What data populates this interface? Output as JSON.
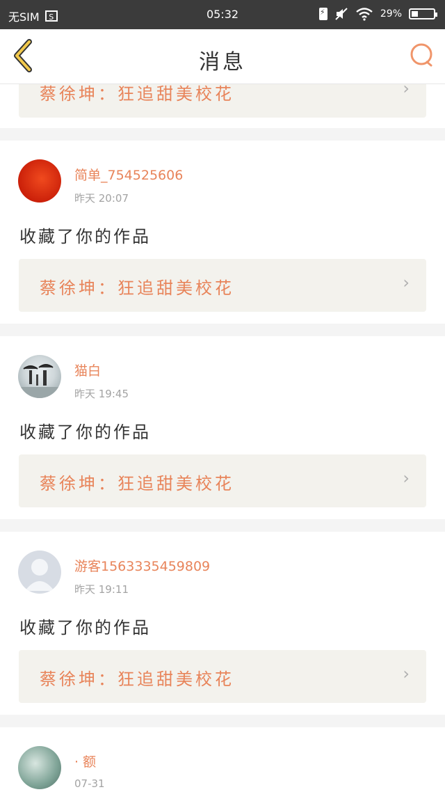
{
  "status_bar": {
    "carrier": "无SIM",
    "sim_icon_text": "S",
    "time": "05:32",
    "battery_percent": "29%",
    "battery_level": 0.29
  },
  "header": {
    "title": "消息",
    "accent_color": "#e8845a",
    "back_icon": "chevron-left-icon",
    "search_icon": "search-icon"
  },
  "partial_top": {
    "work_title": "蔡徐坤：狂追甜美校花"
  },
  "messages": [
    {
      "username": "简单_754525606",
      "time": "昨天 20:07",
      "action": "收藏了你的作品",
      "work_title": "蔡徐坤：狂追甜美校花"
    },
    {
      "username": "猫白",
      "time": "昨天 19:45",
      "action": "收藏了你的作品",
      "work_title": "蔡徐坤：狂追甜美校花"
    },
    {
      "username": "游客1563335459809",
      "time": "昨天 19:11",
      "action": "收藏了你的作品",
      "work_title": "蔡徐坤：狂追甜美校花"
    },
    {
      "username": "· 额",
      "time": "07-31"
    }
  ]
}
